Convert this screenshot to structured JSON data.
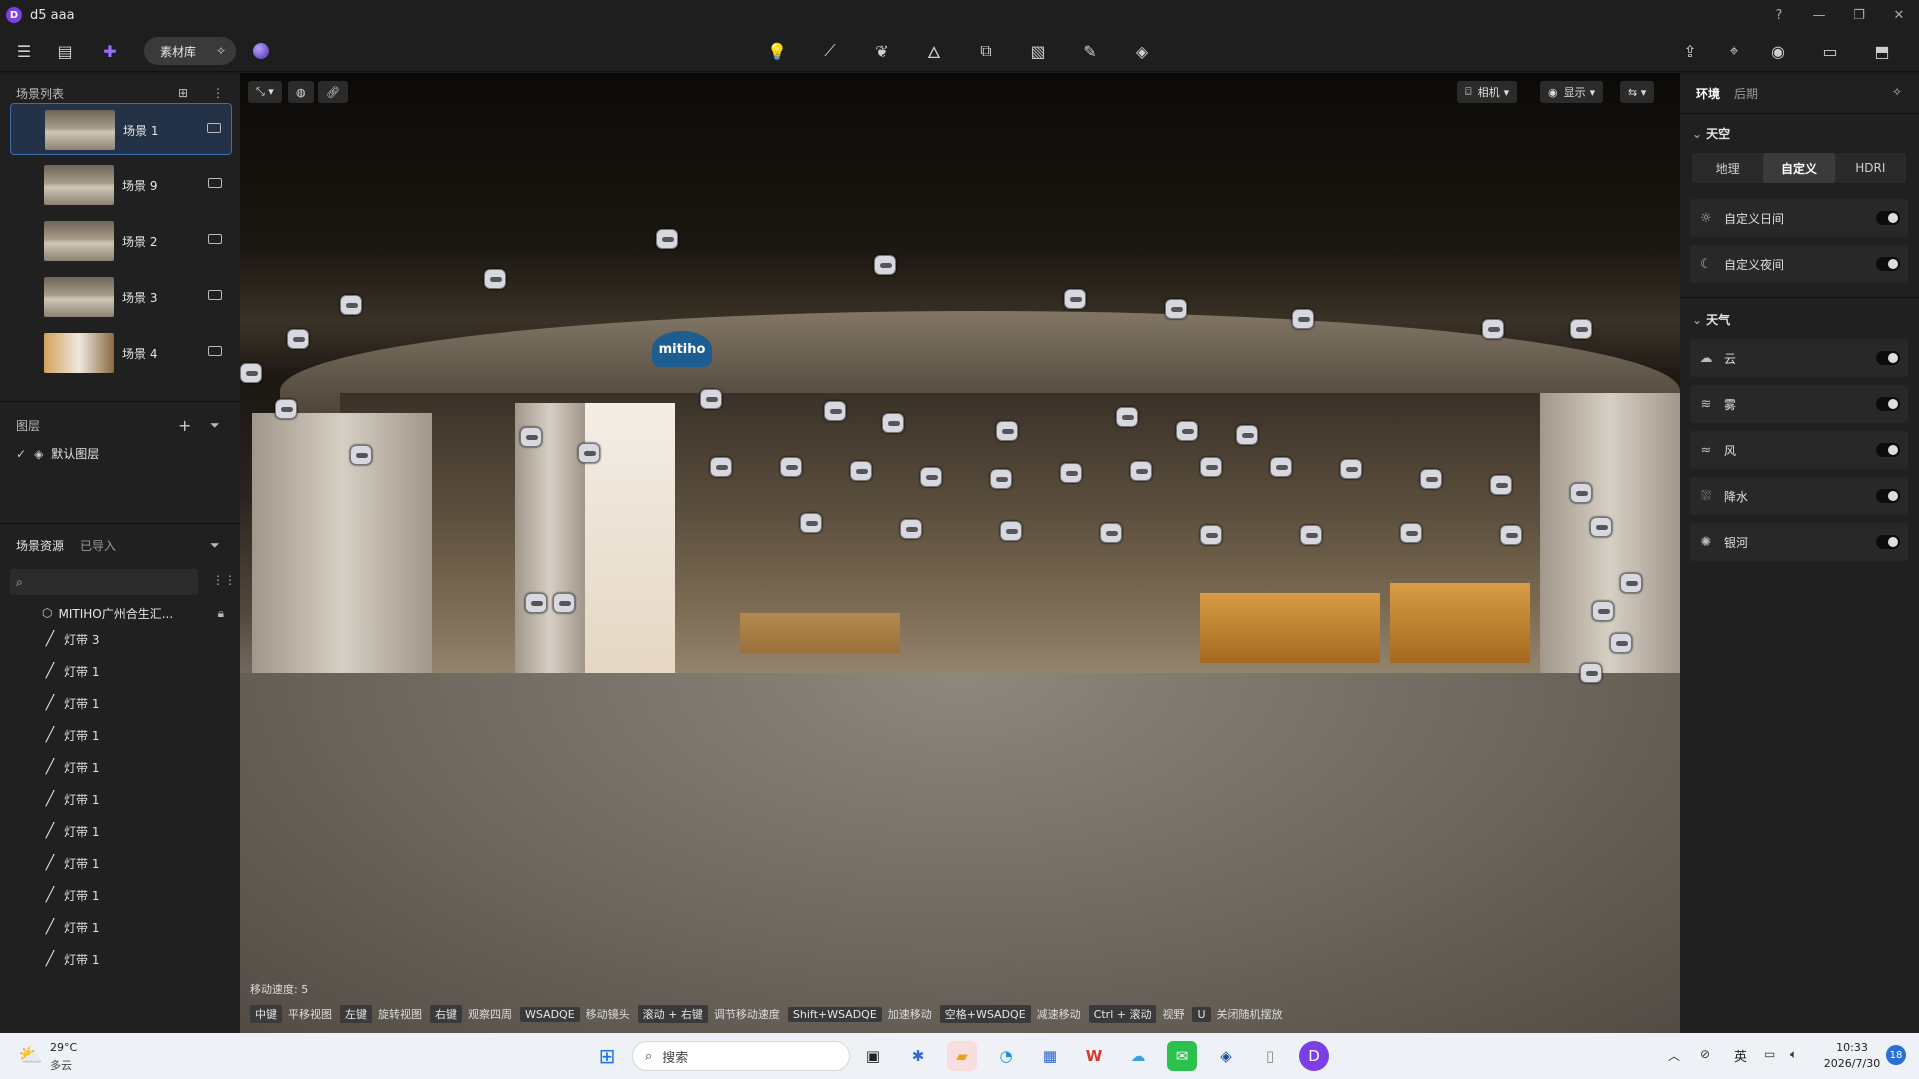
{
  "window": {
    "title": "d5 aaa",
    "logo": "D"
  },
  "toolbar": {
    "material_label": "素材库"
  },
  "left_panel": {
    "scene_list_title": "场景列表",
    "scenes": [
      {
        "name": "场景 1",
        "active": true
      },
      {
        "name": "场景 9",
        "active": false
      },
      {
        "name": "场景 2",
        "active": false
      },
      {
        "name": "场景 3",
        "active": false
      },
      {
        "name": "场景 4",
        "active": false
      }
    ],
    "layers_title": "图层",
    "default_layer": "默认图层",
    "resources_tab": "场景资源",
    "imported_tab": "已导入",
    "model_name": "MITIHO广州合生汇...",
    "tree_items": [
      "灯带 3",
      "灯带 1",
      "灯带 1",
      "灯带 1",
      "灯带 1",
      "灯带 1",
      "灯带 1",
      "灯带 1",
      "灯带 1",
      "灯带 1",
      "灯带 1"
    ]
  },
  "viewport": {
    "sign_text": "mitiho",
    "camera_btn": "相机",
    "display_btn": "显示",
    "move_speed": "移动速度: 5",
    "hints": [
      {
        "key": "中键",
        "desc": "平移视图"
      },
      {
        "key": "左键",
        "desc": "旋转视图"
      },
      {
        "key": "右键",
        "desc": "观察四周"
      },
      {
        "key": "WSADQE",
        "desc": "移动镜头"
      },
      {
        "key": "滚动 + 右键",
        "desc": "调节移动速度"
      },
      {
        "key": "Shift+WSADQE",
        "desc": "加速移动"
      },
      {
        "key": "空格+WSADQE",
        "desc": "减速移动"
      },
      {
        "key": "Ctrl + 滚动",
        "desc": "视野"
      },
      {
        "key": "U",
        "desc": "关闭随机摆放"
      }
    ]
  },
  "right_panel": {
    "tab_env": "环境",
    "tab_post": "后期",
    "sky_title": "天空",
    "sky_modes": [
      "地理",
      "自定义",
      "HDRI"
    ],
    "sky_selected": "自定义",
    "sky_toggles": [
      "自定义日间",
      "自定义夜间"
    ],
    "weather_title": "天气",
    "weather_toggles": [
      "云",
      "雾",
      "风",
      "降水",
      "银河"
    ]
  },
  "taskbar": {
    "temperature": "29°C",
    "weather": "多云",
    "search_placeholder": "搜索",
    "ime": "英",
    "time": "10:33",
    "date": "2026/7/30",
    "notification_count": "18"
  },
  "colors": {
    "accent": "#3b6fb0",
    "brand": "#7b3fe4"
  }
}
